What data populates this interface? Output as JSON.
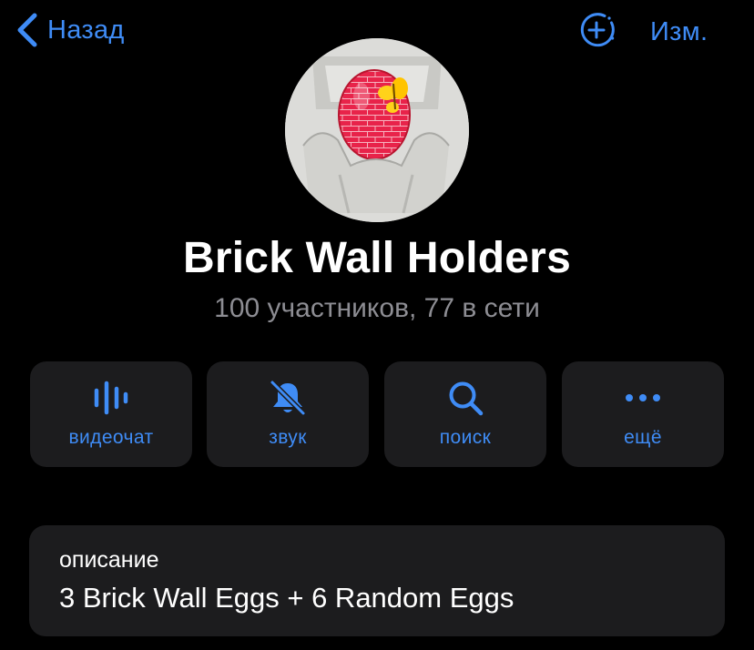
{
  "nav": {
    "back_label": "Назад",
    "edit_label": "Изм."
  },
  "group": {
    "title": "Brick Wall Holders",
    "subtitle": "100 участников, 77 в сети"
  },
  "actions": [
    {
      "label": "видеочат",
      "icon": "voice-chat-icon"
    },
    {
      "label": "звук",
      "icon": "bell-muted-icon"
    },
    {
      "label": "поиск",
      "icon": "search-icon"
    },
    {
      "label": "ещё",
      "icon": "more-dots-icon"
    }
  ],
  "description": {
    "label": "описание",
    "text": "3 Brick Wall Eggs + 6 Random Eggs"
  },
  "colors": {
    "accent": "#3f8cf6",
    "background": "#000000",
    "card": "#1c1c1e",
    "secondary_text": "#8d8d93"
  }
}
